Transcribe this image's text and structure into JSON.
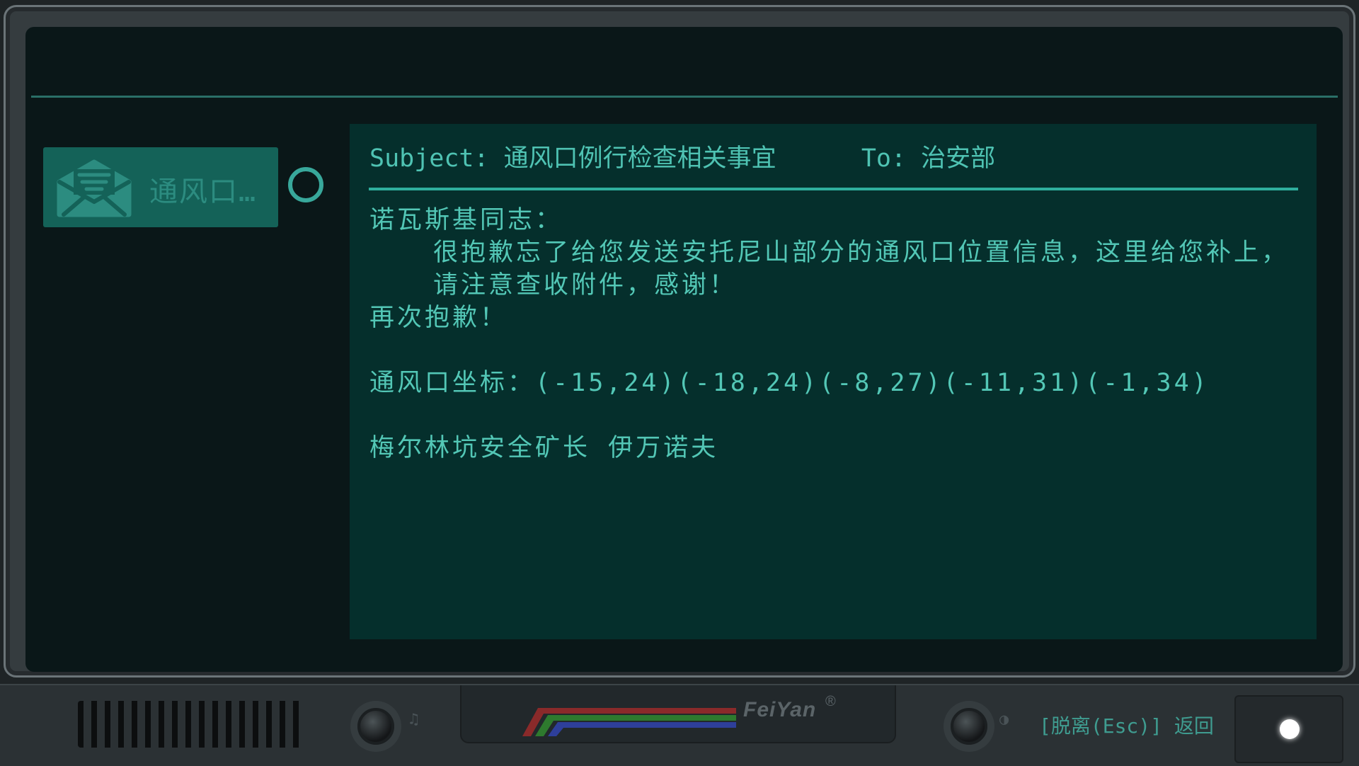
{
  "inbox": {
    "items": [
      {
        "title": "通风口…",
        "icon": "open-envelope-icon",
        "unread_indicator": "ring-icon"
      }
    ]
  },
  "mail": {
    "subject_label": "Subject:",
    "subject": "通风口例行检查相关事宜",
    "to_label": "To:",
    "to": "治安部",
    "greeting": "诺瓦斯基同志：",
    "paragraph": "很抱歉忘了给您发送安托尼山部分的通风口位置信息，这里给您补上，请注意查收附件，感谢！",
    "apology": "再次抱歉！",
    "coordinates_line": "通风口坐标：(-15,24)(-18,24)(-8,27)(-11,31)(-1,34)",
    "signature": "梅尔林坑安全矿长 伊万诺夫"
  },
  "console": {
    "brand": "FeiYan",
    "brand_mark": "®",
    "volume_glyph": "♫",
    "brightness_glyph": "◑",
    "exit_hint": "[脱离(Esc)] 返回"
  },
  "colors": {
    "screen_bg": "#0a1718",
    "panel_bg": "#052f2c",
    "text": "#53c7b6",
    "accent": "#2fae9d",
    "stripe_red": "#8a2a2a",
    "stripe_green": "#2e7a2e",
    "stripe_blue": "#2e3f9a"
  }
}
